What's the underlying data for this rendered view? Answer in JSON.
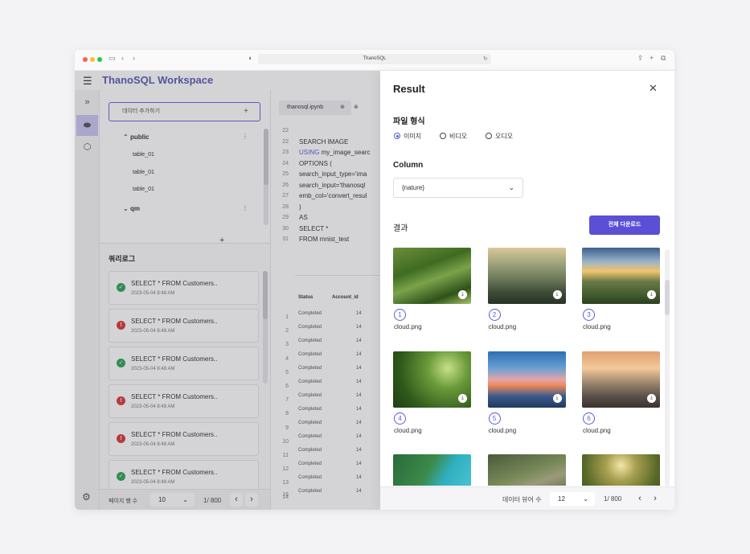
{
  "browser": {
    "url": "ThanoSQL"
  },
  "app": {
    "title": "ThanoSQL Workspace"
  },
  "explorer": {
    "add_data_label": "데이터 추가하기",
    "schemas": [
      {
        "name": "public",
        "tables": [
          "table_01",
          "table_01",
          "table_01"
        ]
      },
      {
        "name": "qm",
        "tables": []
      }
    ]
  },
  "querylog": {
    "title": "쿼리로그",
    "entries": [
      {
        "query": "SELECT * FROM Customers..",
        "time": "2023-05-04 8:48 AM",
        "status": "success"
      },
      {
        "query": "SELECT * FROM Customers..",
        "time": "2023-05-04 8:48 AM",
        "status": "error"
      },
      {
        "query": "SELECT * FROM Customers..",
        "time": "2023-05-04 8:48 AM",
        "status": "success"
      },
      {
        "query": "SELECT * FROM Customers..",
        "time": "2023-05-04 8:48 AM",
        "status": "error"
      },
      {
        "query": "SELECT * FROM Customers..",
        "time": "2023-05-04 8:48 AM",
        "status": "error"
      },
      {
        "query": "SELECT * FROM Customers..",
        "time": "2023-05-04 8:48 AM",
        "status": "success"
      }
    ],
    "pager": {
      "rows_label": "페이지 행 수",
      "rows_value": "10",
      "page": "1/ 800"
    }
  },
  "editor": {
    "tab_name": "thanosql.ipynb",
    "code": [
      {
        "num": "22",
        "text": ""
      },
      {
        "num": "22",
        "text": "SEARCH IMAGE"
      },
      {
        "num": "23",
        "kw": "USING",
        "text": " my_image_searc"
      },
      {
        "num": "24",
        "text": "OPTIONS ("
      },
      {
        "num": "25",
        "text": "search_input_type='ima"
      },
      {
        "num": "26",
        "text": "search_input='thanosql"
      },
      {
        "num": "27",
        "text": "emb_col='convert_resul"
      },
      {
        "num": "28",
        "text": ")"
      },
      {
        "num": "29",
        "text": "AS"
      },
      {
        "num": "30",
        "text": "SELECT *"
      },
      {
        "num": "31",
        "text": "FROM mnist_test"
      }
    ],
    "table": {
      "headers": [
        "Status",
        "Account_id"
      ],
      "row_numbers": [
        "1",
        "2",
        "3",
        "4",
        "5",
        "6",
        "7",
        "8",
        "9",
        "10",
        "11",
        "12",
        "13",
        "14"
      ],
      "rows": [
        [
          "Completed",
          "14"
        ],
        [
          "Completed",
          "14"
        ],
        [
          "Completed",
          "14"
        ],
        [
          "Completed",
          "14"
        ],
        [
          "Completed",
          "14"
        ],
        [
          "Completed",
          "14"
        ],
        [
          "Completed",
          "14"
        ],
        [
          "Completed",
          "14"
        ],
        [
          "Completed",
          "14"
        ],
        [
          "Completed",
          "14"
        ],
        [
          "Completed",
          "14"
        ],
        [
          "Completed",
          "14"
        ],
        [
          "Completed",
          "14"
        ],
        [
          "Completed",
          "14"
        ]
      ],
      "bottom_line_num": "16"
    }
  },
  "result": {
    "title": "Result",
    "file_type_label": "파일 형식",
    "file_types": [
      {
        "label": "이미지",
        "selected": true
      },
      {
        "label": "비디오",
        "selected": false
      },
      {
        "label": "오디오",
        "selected": false
      }
    ],
    "column_label": "Column",
    "column_value": "{nature}",
    "results_label": "결과",
    "download_all": "전체 다운로드",
    "images": [
      {
        "num": "1",
        "name": "cloud.png",
        "scene": "green-hills"
      },
      {
        "num": "2",
        "name": "cloud.png",
        "scene": "misty-mountains"
      },
      {
        "num": "3",
        "name": "cloud.png",
        "scene": "sunset-valley"
      },
      {
        "num": "4",
        "name": "cloud.png",
        "scene": "leaf-bokeh"
      },
      {
        "num": "5",
        "name": "cloud.png",
        "scene": "ocean-sunset"
      },
      {
        "num": "6",
        "name": "cloud.png",
        "scene": "grass-sunset"
      },
      {
        "num": "",
        "name": "",
        "scene": "aerial-forest-water"
      },
      {
        "num": "",
        "name": "",
        "scene": "mountain-road"
      },
      {
        "num": "",
        "name": "",
        "scene": "forest-sunlight"
      }
    ],
    "pager": {
      "view_label": "데이터 뷰어 수",
      "view_value": "12",
      "page": "1/ 800"
    }
  },
  "colors": {
    "accent": "#5b4fd6",
    "success": "#2fa55a",
    "error": "#d93b3b"
  }
}
